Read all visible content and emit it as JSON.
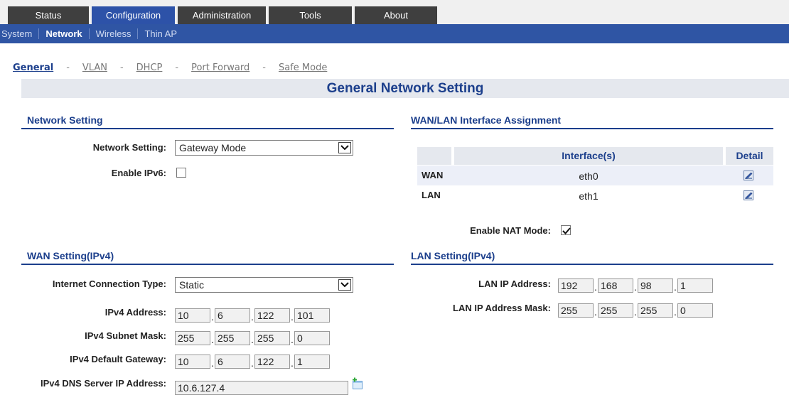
{
  "top_tabs": [
    {
      "label": "Status"
    },
    {
      "label": "Configuration"
    },
    {
      "label": "Administration"
    },
    {
      "label": "Tools"
    },
    {
      "label": "About"
    }
  ],
  "sub_nav": [
    {
      "label": "System"
    },
    {
      "label": "Network"
    },
    {
      "label": "Wireless"
    },
    {
      "label": "Thin AP"
    }
  ],
  "page_tabs": [
    {
      "label": "General"
    },
    {
      "label": "VLAN"
    },
    {
      "label": "DHCP"
    },
    {
      "label": "Port Forward"
    },
    {
      "label": "Safe Mode"
    }
  ],
  "page_tab_separator": "-",
  "title": "General Network Setting",
  "network_setting": {
    "heading": "Network Setting",
    "mode_label": "Network Setting:",
    "mode_value": "Gateway Mode",
    "ipv6_label": "Enable IPv6:",
    "ipv6_checked": false
  },
  "wan_lan_assignment": {
    "heading": "WAN/LAN Interface Assignment",
    "col_interfaces": "Interface(s)",
    "col_detail": "Detail",
    "rows": [
      {
        "name": "WAN",
        "interface": "eth0"
      },
      {
        "name": "LAN",
        "interface": "eth1"
      }
    ],
    "nat_label": "Enable NAT Mode:",
    "nat_checked": true
  },
  "wan_setting": {
    "heading": "WAN Setting(IPv4)",
    "conn_type_label": "Internet Connection Type:",
    "conn_type_value": "Static",
    "ipv4_address_label": "IPv4 Address:",
    "ipv4_address": [
      "10",
      "6",
      "122",
      "101"
    ],
    "subnet_mask_label": "IPv4 Subnet Mask:",
    "subnet_mask": [
      "255",
      "255",
      "255",
      "0"
    ],
    "gateway_label": "IPv4 Default Gateway:",
    "gateway": [
      "10",
      "6",
      "122",
      "1"
    ],
    "dns_label": "IPv4 DNS Server IP Address:",
    "dns_value": "10.6.127.4"
  },
  "lan_setting": {
    "heading": "LAN Setting(IPv4)",
    "ip_label": "LAN IP Address:",
    "ip": [
      "192",
      "168",
      "98",
      "1"
    ],
    "mask_label": "LAN IP Address Mask:",
    "mask": [
      "255",
      "255",
      "255",
      "0"
    ]
  },
  "ip_separator": ".",
  "colors": {
    "active_tab": "#2d52a8",
    "inactive_tab": "#3f3f3f",
    "subnav_bg": "#2f55a4",
    "heading_blue": "#1c3f8c",
    "title_bar_bg": "#e5e8ee"
  },
  "icons": {
    "edit": "edit-icon",
    "add": "add-icon",
    "dropdown": "chevron-down-icon",
    "check": "check-icon"
  }
}
